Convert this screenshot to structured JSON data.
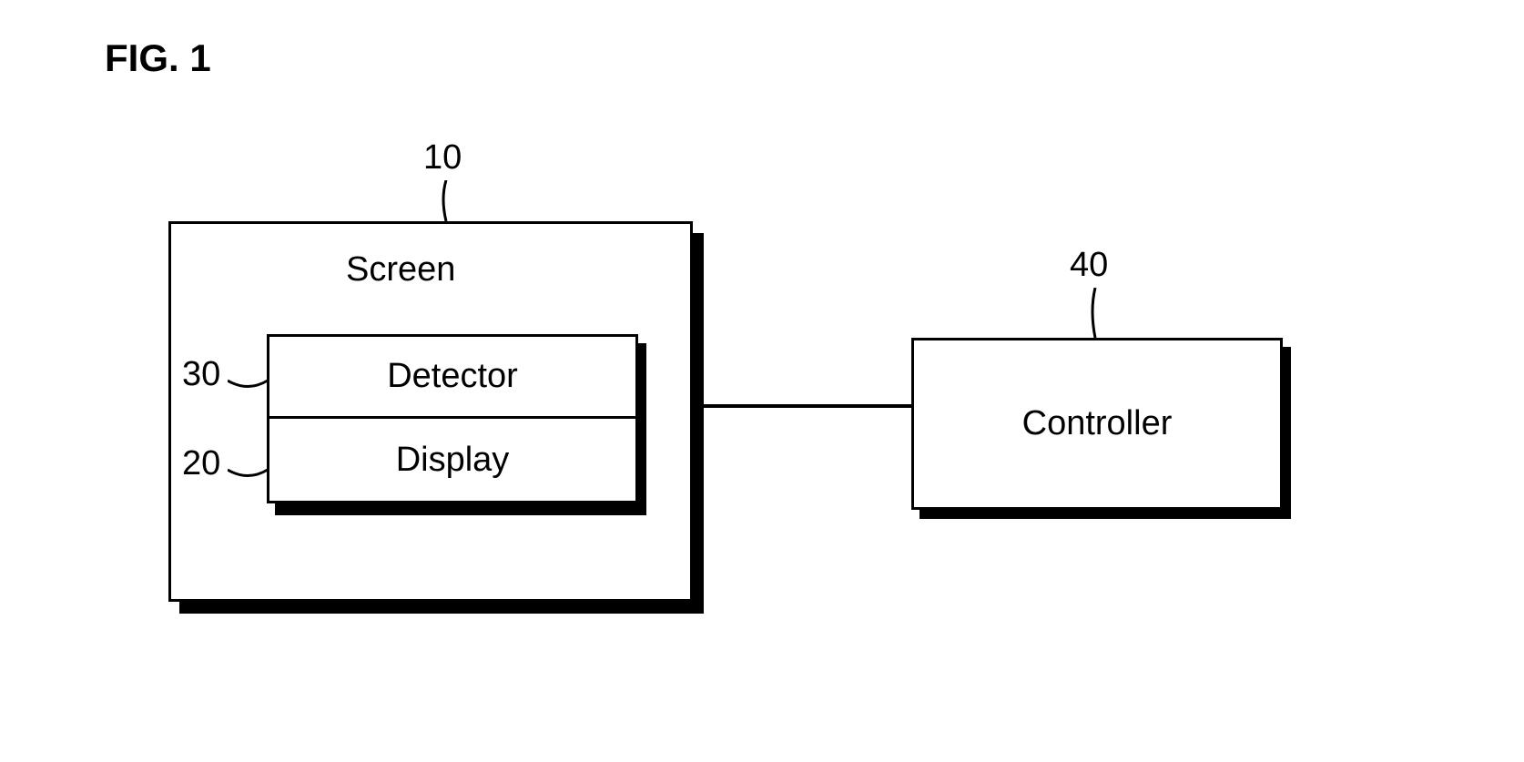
{
  "figure_title": "FIG. 1",
  "screen": {
    "label": "Screen",
    "ref": "10",
    "detector": {
      "label": "Detector",
      "ref": "30"
    },
    "display": {
      "label": "Display",
      "ref": "20"
    }
  },
  "controller": {
    "label": "Controller",
    "ref": "40"
  }
}
